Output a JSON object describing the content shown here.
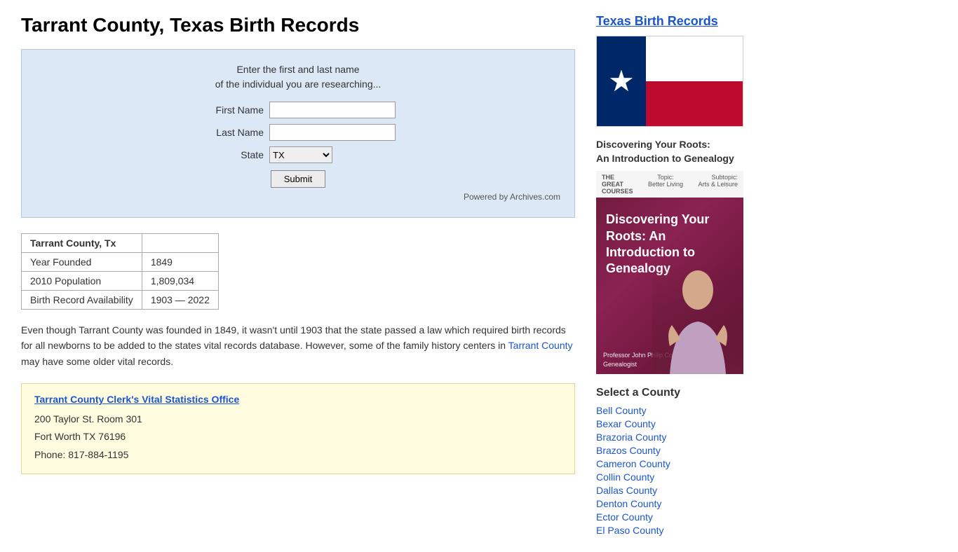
{
  "page": {
    "title": "Tarrant County, Texas Birth Records"
  },
  "search": {
    "instruction_line1": "Enter the first and last name",
    "instruction_line2": "of the individual you are researching...",
    "first_name_label": "First Name",
    "last_name_label": "Last Name",
    "state_label": "State",
    "state_value": "TX",
    "submit_label": "Submit",
    "powered_by": "Powered by Archives.com"
  },
  "info_table": {
    "county_header": "Tarrant County, Tx",
    "rows": [
      {
        "label": "Year Founded",
        "value": "1849"
      },
      {
        "label": "2010 Population",
        "value": "1,809,034"
      },
      {
        "label": "Birth Record Availability",
        "value": "1903 — 2022"
      }
    ]
  },
  "description": {
    "text": "Even though Tarrant County was founded in 1849, it wasn't until 1903 that the state passed a law which required birth records for all newborns to be added to the states vital records database. However, some of the family history centers in Tarrant County may have some older vital records.",
    "link_text": "Tarrant County"
  },
  "office": {
    "name": "Tarrant County Clerk's Vital Statistics Office",
    "address_line1": "200 Taylor St. Room 301",
    "address_line2": "Fort Worth TX 76196",
    "phone": "Phone: 817-884-1195"
  },
  "sidebar": {
    "texas_birth_records_link": "Texas Birth Records",
    "genealogy_title_line1": "Discovering Your Roots:",
    "genealogy_title_line2": "An Introduction to Genealogy",
    "book_title": "Discovering Your Roots: An Introduction to Genealogy",
    "book_top_left": "THE GREAT COURSES",
    "book_top_right_line1": "Topic:",
    "book_top_right_line2": "Better Living",
    "book_top_right3": "Subtopic: Arts & Leisure",
    "professor_line1": "Professor John Philip Colletta",
    "professor_line2": "Genealogist",
    "select_county_title": "Select a County",
    "counties": [
      {
        "name": "Bell County",
        "href": "#"
      },
      {
        "name": "Bexar County",
        "href": "#"
      },
      {
        "name": "Brazoria County",
        "href": "#"
      },
      {
        "name": "Brazos County",
        "href": "#"
      },
      {
        "name": "Cameron County",
        "href": "#"
      },
      {
        "name": "Collin County",
        "href": "#"
      },
      {
        "name": "Dallas County",
        "href": "#"
      },
      {
        "name": "Denton County",
        "href": "#"
      },
      {
        "name": "Ector County",
        "href": "#"
      },
      {
        "name": "El Paso County",
        "href": "#"
      }
    ]
  }
}
